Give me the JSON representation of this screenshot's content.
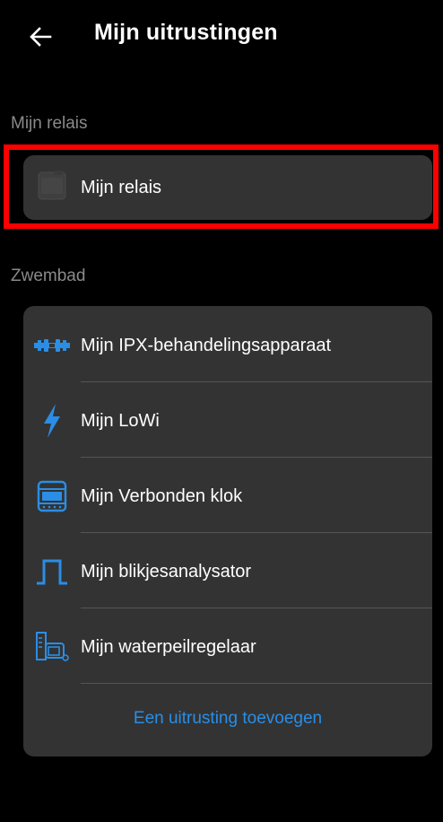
{
  "header": {
    "title": "Mijn uitrustingen"
  },
  "relay_section": {
    "label": "Mijn relais",
    "items": [
      {
        "label": "Mijn relais",
        "icon": "relay-device-icon"
      }
    ]
  },
  "pool_section": {
    "label": "Zwembad",
    "items": [
      {
        "label": "Mijn IPX-behandelingsapparaat",
        "icon": "ipx-device-icon"
      },
      {
        "label": "Mijn LoWi",
        "icon": "lightning-icon"
      },
      {
        "label": "Mijn Verbonden klok",
        "icon": "connected-clock-icon"
      },
      {
        "label": "Mijn blikjesanalysator",
        "icon": "pulse-wave-icon"
      },
      {
        "label": "Mijn waterpeilregelaar",
        "icon": "water-level-icon"
      }
    ],
    "add_label": "Een uitrusting toevoegen"
  },
  "colors": {
    "background": "#000000",
    "card": "#333333",
    "accent": "#2a8ee6",
    "highlight": "#ff0000",
    "muted_text": "#8a8a8a"
  }
}
